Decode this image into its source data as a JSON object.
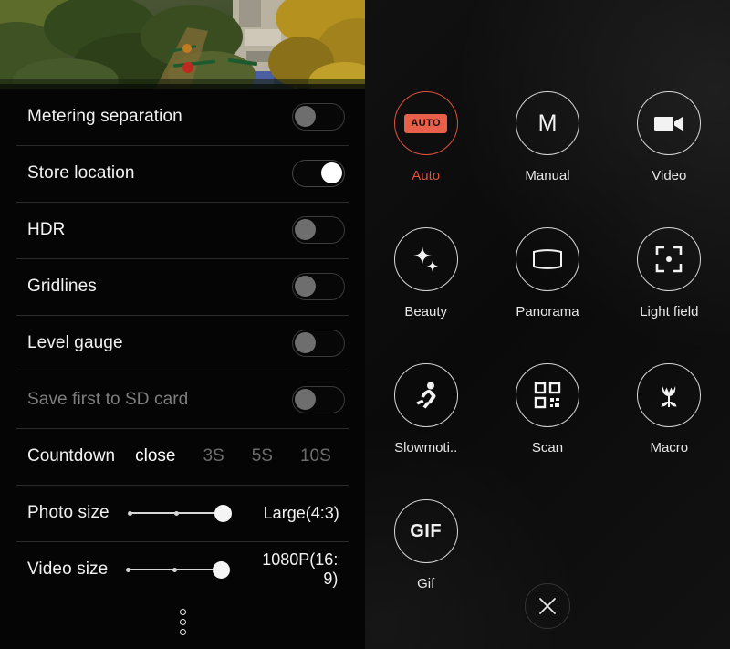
{
  "settings_panel": {
    "viewfinder": {
      "name": "camera-preview",
      "description": "Garden scene with trees and foliage"
    },
    "rows": [
      {
        "label": "Metering separation",
        "control": "toggle",
        "value": "off",
        "disabled": false
      },
      {
        "label": "Store location",
        "control": "toggle",
        "value": "on",
        "disabled": false
      },
      {
        "label": "HDR",
        "control": "toggle",
        "value": "off",
        "disabled": false
      },
      {
        "label": "Gridlines",
        "control": "toggle",
        "value": "off",
        "disabled": false
      },
      {
        "label": "Level gauge",
        "control": "toggle",
        "value": "off",
        "disabled": false
      },
      {
        "label": "Save first to SD card",
        "control": "toggle",
        "value": "off",
        "disabled": true
      }
    ],
    "countdown": {
      "label": "Countdown",
      "options": [
        "close",
        "3S",
        "5S",
        "10S"
      ],
      "selected": "close"
    },
    "photo_size": {
      "label": "Photo size",
      "value": "Large(4:3)",
      "steps": 3,
      "selected_step": 3
    },
    "video_size": {
      "label": "Video size",
      "value": "1080P(16:9)",
      "value_line1": "1080P(16:",
      "value_line2": "9)",
      "steps": 3,
      "selected_step": 3
    },
    "more_handle": "more-options-dots"
  },
  "mode_panel": {
    "modes": [
      {
        "label": "Auto",
        "icon": "auto-badge-icon",
        "active": true
      },
      {
        "label": "Manual",
        "icon": "manual-m-icon",
        "active": false
      },
      {
        "label": "Video",
        "icon": "video-camera-icon",
        "active": false
      },
      {
        "label": "Beauty",
        "icon": "sparkles-icon",
        "active": false
      },
      {
        "label": "Panorama",
        "icon": "panorama-icon",
        "active": false
      },
      {
        "label": "Light field",
        "icon": "focus-bracket-icon",
        "active": false
      },
      {
        "label": "Slowmoti..",
        "icon": "running-person-icon",
        "active": false
      },
      {
        "label": "Scan",
        "icon": "qr-code-icon",
        "active": false
      },
      {
        "label": "Macro",
        "icon": "tulip-flower-icon",
        "active": false
      },
      {
        "label": "Gif",
        "icon": "gif-text-icon",
        "active": false
      }
    ],
    "auto_badge_text": "AUTO",
    "gif_text": "GIF",
    "close_button": "close-icon"
  },
  "colors": {
    "accent": "#e0523c",
    "auto_badge_bg": "#e8604a",
    "panel_bg": "#050505",
    "text_primary": "#f2f2f2",
    "text_dim": "#6d6d6d",
    "toggle_off_knob": "#6e6e6e",
    "toggle_on_knob": "#ffffff",
    "divider": "#2b2b2b"
  }
}
